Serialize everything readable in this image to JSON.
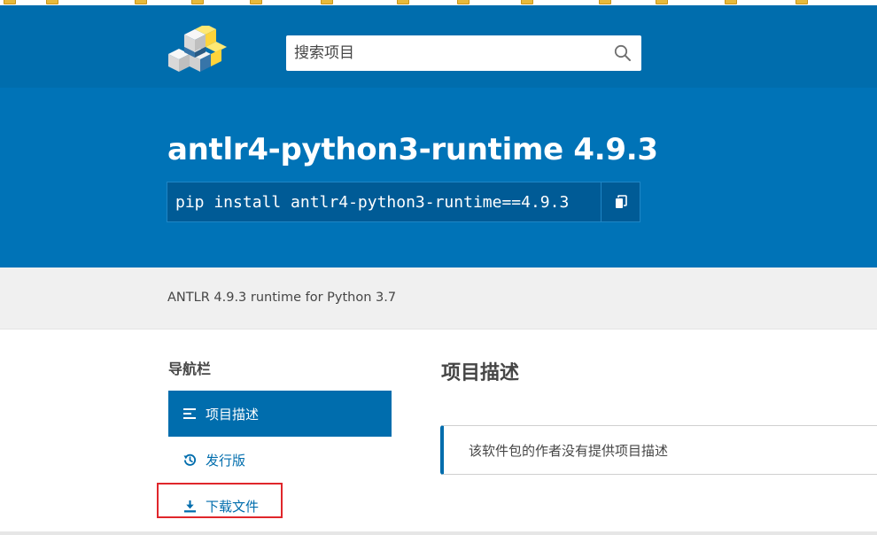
{
  "search": {
    "placeholder": "搜索项目"
  },
  "package": {
    "title": "antlr4-python3-runtime 4.9.3",
    "pip_command": "pip install antlr4-python3-runtime==4.9.3"
  },
  "summary": "ANTLR 4.9.3 runtime for Python 3.7",
  "sidebar": {
    "title": "导航栏",
    "items": [
      {
        "label": "项目描述",
        "icon": "align-left-icon",
        "active": true
      },
      {
        "label": "发行版",
        "icon": "history-icon",
        "active": false
      },
      {
        "label": "下载文件",
        "icon": "download-icon",
        "active": false
      }
    ]
  },
  "main": {
    "title": "项目描述",
    "callout": "该软件包的作者没有提供项目描述"
  },
  "colors": {
    "header": "#006dad",
    "banner": "#0073b7",
    "accent": "#006dad",
    "highlight": "#e0262b"
  }
}
